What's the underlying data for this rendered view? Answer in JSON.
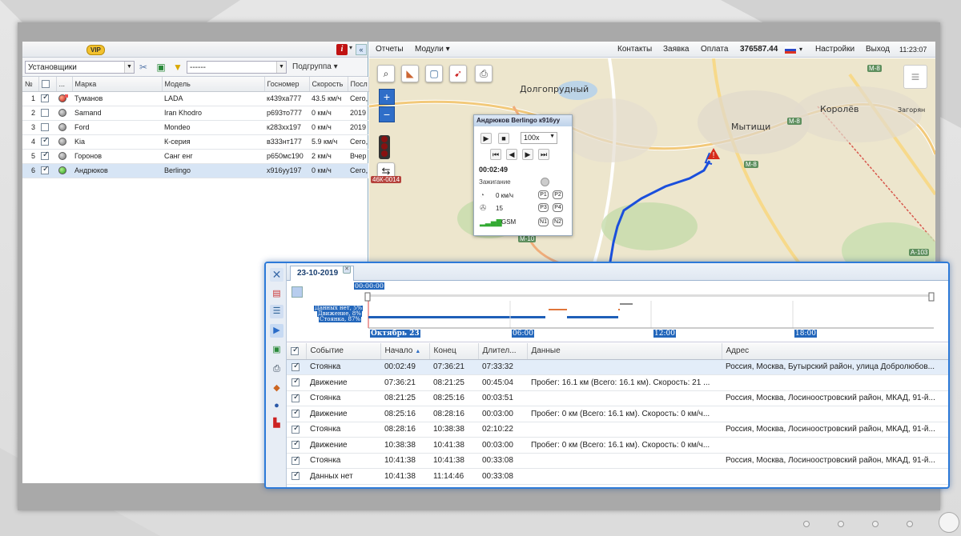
{
  "left_panel": {
    "vip_badge": "VIP",
    "group_select": "Установщики",
    "filter_select": "------",
    "subgroup_label": "Подгруппа ▾",
    "columns": [
      "№",
      "",
      "...",
      "Марка",
      "Модель",
      "Госномер",
      "Скорость",
      "Посл"
    ],
    "rows": [
      {
        "num": "1",
        "checked": true,
        "status": "red",
        "brand": "Туманов",
        "model": "LADA",
        "plate": "к439ха777",
        "speed": "43.5 км/ч",
        "last": "Сего,",
        "selected": false
      },
      {
        "num": "2",
        "checked": false,
        "status": "gray",
        "brand": "Samand",
        "model": "Iran Khodro",
        "plate": "р693то777",
        "speed": "0 км/ч",
        "last": "2019",
        "selected": false
      },
      {
        "num": "3",
        "checked": false,
        "status": "gray",
        "brand": "Ford",
        "model": "Mondeo",
        "plate": "к283хх197",
        "speed": "0 км/ч",
        "last": "2019",
        "selected": false
      },
      {
        "num": "4",
        "checked": true,
        "status": "gray",
        "brand": "Kia",
        "model": "К-серия",
        "plate": "в333нт177",
        "speed": "5.9 км/ч",
        "last": "Сего,",
        "selected": false
      },
      {
        "num": "5",
        "checked": true,
        "status": "gray",
        "brand": "Горонов",
        "model": "Санг енг",
        "plate": "р650мс190",
        "speed": "2 км/ч",
        "last": "Вчер",
        "selected": false
      },
      {
        "num": "6",
        "checked": true,
        "status": "green",
        "brand": "Андрюков",
        "model": "Berlingo",
        "plate": "х916уу197",
        "speed": "0 км/ч",
        "last": "Сего,",
        "selected": true
      }
    ]
  },
  "top_nav": {
    "reports": "Отчеты",
    "modules": "Модули ▾",
    "contacts": "Контакты",
    "request": "Заявка",
    "payment": "Оплата",
    "balance": "376587.44",
    "flag_dropdown": "▾",
    "settings": "Настройки",
    "exit": "Выход",
    "time": "11:23:07"
  },
  "map": {
    "labels": [
      "Долгопрудный",
      "Королёв",
      "Мытищи",
      "Загорян"
    ],
    "road_labels": [
      "46К-0014",
      "М-8",
      "М-8",
      "М-8",
      "А-103",
      "М-10"
    ]
  },
  "player": {
    "title": "Андрюков Berlingo к916уу",
    "speed_select": "100х",
    "time": "00:02:49",
    "ignition_label": "Зажигание",
    "speed": "0 км/ч",
    "satellites": "15",
    "gsm_label": "GSM",
    "badges": [
      "P1",
      "P2",
      "P3",
      "P4",
      "N1",
      "N2"
    ]
  },
  "bottom_panel": {
    "tab_label": "23-10-2019",
    "timeline": {
      "cursor_time": "00:00:00",
      "legend": [
        "Данных нет, 5%",
        "Движение, 8%",
        "Стоянка, 87%"
      ],
      "axis": [
        "Октябрь 23",
        "06:00",
        "12:00",
        "18:00"
      ]
    },
    "columns": [
      "Событие",
      "Начало",
      "Конец",
      "Длител...",
      "Данные",
      "Адрес"
    ],
    "rows": [
      {
        "event": "Стоянка",
        "start": "00:02:49",
        "end": "07:36:21",
        "duration": "07:33:32",
        "data": "",
        "address": "Россия, Москва, Бутырский район, улица Добролюбов..."
      },
      {
        "event": "Движение",
        "start": "07:36:21",
        "end": "08:21:25",
        "duration": "00:45:04",
        "data": "Пробег: 16.1 км (Всего: 16.1 км). Скорость: 21 ...",
        "address": ""
      },
      {
        "event": "Стоянка",
        "start": "08:21:25",
        "end": "08:25:16",
        "duration": "00:03:51",
        "data": "",
        "address": "Россия, Москва, Лосиноостровский район, МКАД, 91-й..."
      },
      {
        "event": "Движение",
        "start": "08:25:16",
        "end": "08:28:16",
        "duration": "00:03:00",
        "data": "Пробег: 0 км (Всего: 16.1 км). Скорость: 0 км/ч...",
        "address": ""
      },
      {
        "event": "Стоянка",
        "start": "08:28:16",
        "end": "10:38:38",
        "duration": "02:10:22",
        "data": "",
        "address": "Россия, Москва, Лосиноостровский район, МКАД, 91-й..."
      },
      {
        "event": "Движение",
        "start": "10:38:38",
        "end": "10:41:38",
        "duration": "00:03:00",
        "data": "Пробег: 0 км (Всего: 16.1 км). Скорость: 0 км/ч...",
        "address": ""
      },
      {
        "event": "Стоянка",
        "start": "10:41:38",
        "end": "10:41:38",
        "duration": "00:33:08",
        "data": "",
        "address": "Россия, Москва, Лосиноостровский район, МКАД, 91-й..."
      },
      {
        "event": "Данных нет",
        "start": "10:41:38",
        "end": "11:14:46",
        "duration": "00:33:08",
        "data": "",
        "address": ""
      }
    ]
  }
}
